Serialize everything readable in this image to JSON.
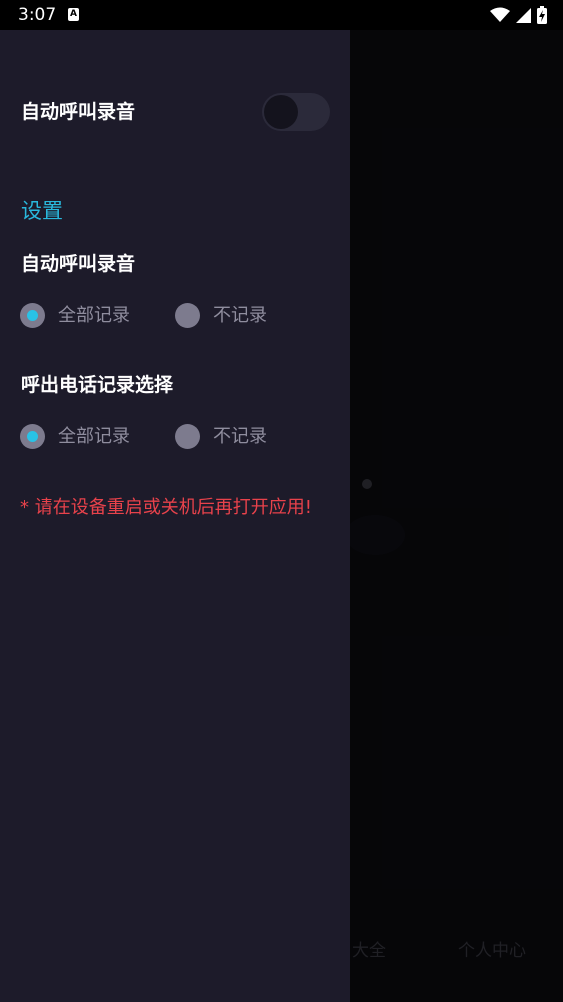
{
  "status_bar": {
    "time": "3:07",
    "notification_icon": "A",
    "icons": [
      "wifi-icon",
      "cell-signal-icon",
      "battery-charging-icon"
    ]
  },
  "drawer": {
    "auto_record_toggle": {
      "label": "自动呼叫录音",
      "on": false
    },
    "section_title": "设置",
    "groups": [
      {
        "title": "自动呼叫录音",
        "options": [
          "全部记录",
          "不记录"
        ],
        "selected": "全部记录"
      },
      {
        "title": "呼出电话记录选择",
        "options": [
          "全部记录",
          "不记录"
        ],
        "selected": "全部记录"
      }
    ],
    "warning": "* 请在设备重启或关机后再打开应用!"
  },
  "background_app": {
    "tabs": [
      "大全",
      "个人中心"
    ]
  },
  "colors": {
    "accent": "#29b8dc",
    "warning": "#e8424b",
    "drawer_bg": "#1d1b2a"
  }
}
